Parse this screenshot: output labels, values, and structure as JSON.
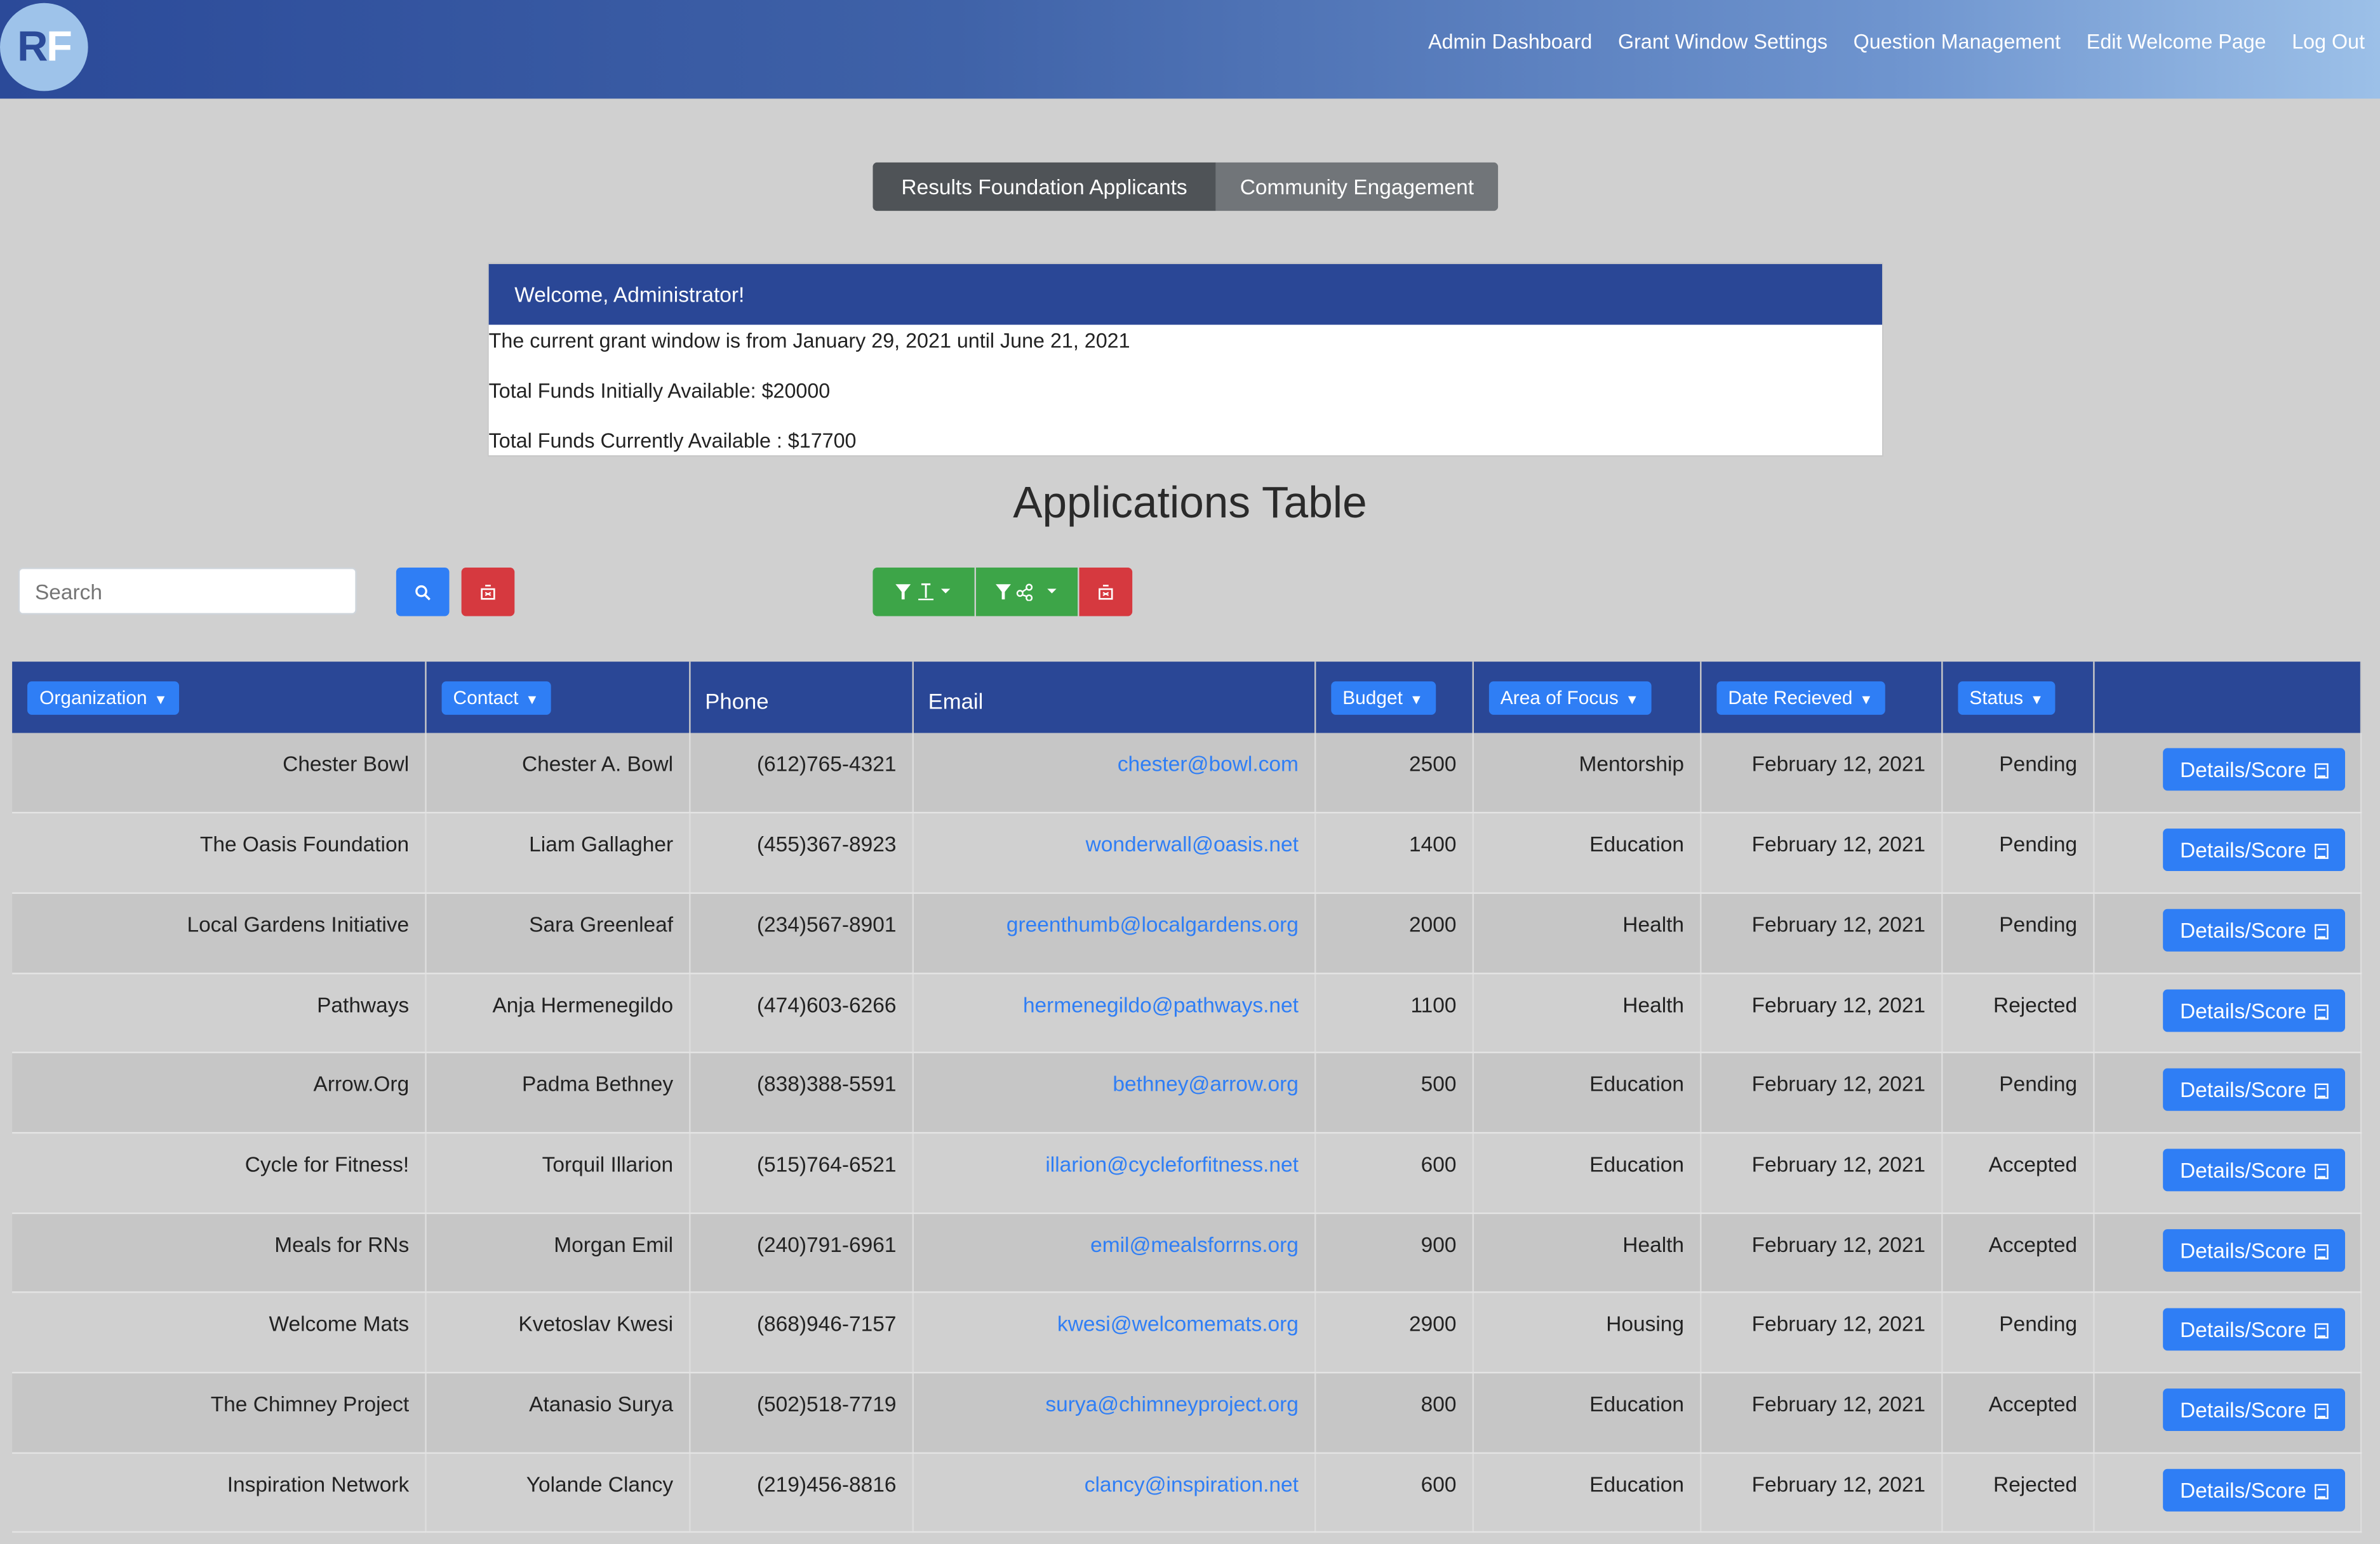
{
  "logo": {
    "text_r": "R",
    "text_f": "F"
  },
  "nav": [
    "Admin Dashboard",
    "Grant Window Settings",
    "Question Management",
    "Edit Welcome Page",
    "Log Out"
  ],
  "tabs": {
    "active": "Results Foundation Applicants",
    "inactive": "Community Engagement"
  },
  "welcome": {
    "heading": "Welcome, Administrator!",
    "window": "The current grant window is from January 29, 2021 until June 21, 2021",
    "initial": "Total Funds Initially Available: $20000",
    "current": "Total Funds Currently Available : $17700"
  },
  "page_title": "Applications Table",
  "search": {
    "placeholder": "Search"
  },
  "columns": {
    "organization": "Organization",
    "contact": "Contact",
    "phone": "Phone",
    "email": "Email",
    "budget": "Budget",
    "area": "Area of Focus",
    "date": "Date Recieved",
    "status": "Status"
  },
  "row_button": "Details/Score",
  "rows": [
    {
      "org": "Chester Bowl",
      "contact": "Chester A. Bowl",
      "phone": "(612)765-4321",
      "email": "chester@bowl.com",
      "budget": "2500",
      "area": "Mentorship",
      "date": "February 12, 2021",
      "status": "Pending"
    },
    {
      "org": "The Oasis Foundation",
      "contact": "Liam Gallagher",
      "phone": "(455)367-8923",
      "email": "wonderwall@oasis.net",
      "budget": "1400",
      "area": "Education",
      "date": "February 12, 2021",
      "status": "Pending"
    },
    {
      "org": "Local Gardens Initiative",
      "contact": "Sara Greenleaf",
      "phone": "(234)567-8901",
      "email": "greenthumb@localgardens.org",
      "budget": "2000",
      "area": "Health",
      "date": "February 12, 2021",
      "status": "Pending"
    },
    {
      "org": "Pathways",
      "contact": "Anja Hermenegildo",
      "phone": "(474)603-6266",
      "email": "hermenegildo@pathways.net",
      "budget": "1100",
      "area": "Health",
      "date": "February 12, 2021",
      "status": "Rejected"
    },
    {
      "org": "Arrow.Org",
      "contact": "Padma Bethney",
      "phone": "(838)388-5591",
      "email": "bethney@arrow.org",
      "budget": "500",
      "area": "Education",
      "date": "February 12, 2021",
      "status": "Pending"
    },
    {
      "org": "Cycle for Fitness!",
      "contact": "Torquil Illarion",
      "phone": "(515)764-6521",
      "email": "illarion@cycleforfitness.net",
      "budget": "600",
      "area": "Education",
      "date": "February 12, 2021",
      "status": "Accepted"
    },
    {
      "org": "Meals for RNs",
      "contact": "Morgan Emil",
      "phone": "(240)791-6961",
      "email": "emil@mealsforrns.org",
      "budget": "900",
      "area": "Health",
      "date": "February 12, 2021",
      "status": "Accepted"
    },
    {
      "org": "Welcome Mats",
      "contact": "Kvetoslav Kwesi",
      "phone": "(868)946-7157",
      "email": "kwesi@welcomemats.org",
      "budget": "2900",
      "area": "Housing",
      "date": "February 12, 2021",
      "status": "Pending"
    },
    {
      "org": "The Chimney Project",
      "contact": "Atanasio Surya",
      "phone": "(502)518-7719",
      "email": "surya@chimneyproject.org",
      "budget": "800",
      "area": "Education",
      "date": "February 12, 2021",
      "status": "Accepted"
    },
    {
      "org": "Inspiration Network",
      "contact": "Yolande Clancy",
      "phone": "(219)456-8816",
      "email": "clancy@inspiration.net",
      "budget": "600",
      "area": "Education",
      "date": "February 12, 2021",
      "status": "Rejected"
    }
  ],
  "colors": {
    "navy": "#2a4796",
    "primary": "#2f7ef5",
    "danger": "#d6393f",
    "success": "#3da548"
  }
}
